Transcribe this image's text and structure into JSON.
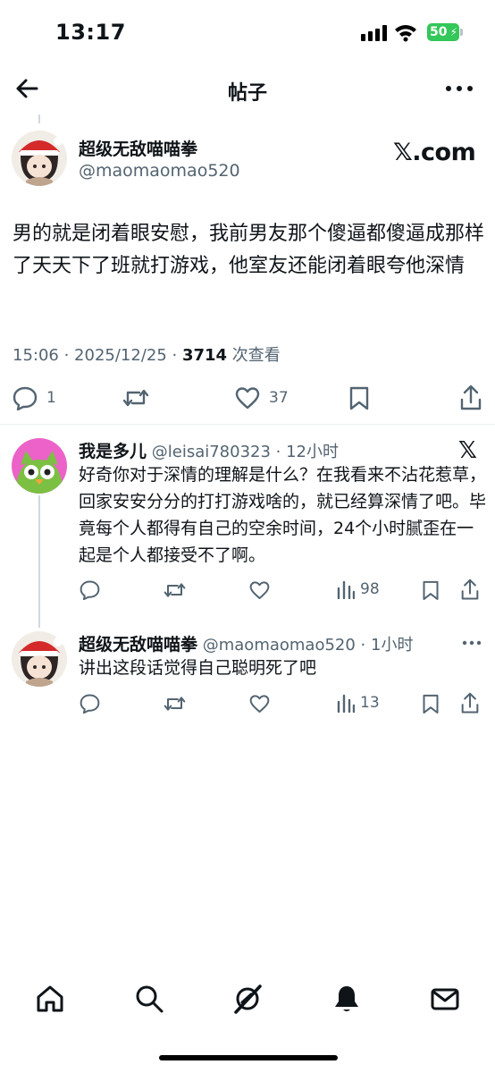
{
  "status_bar": {
    "time": "13:17",
    "battery": "50",
    "battery_color": "#34c759"
  },
  "header": {
    "title": "帖子",
    "back_icon": "arrow-left-icon",
    "more_icon": "ellipsis-horizontal-icon"
  },
  "post": {
    "author_name": "超级无敌喵喵拳",
    "author_handle": "@maomaomao520",
    "badge": "𝕏.com",
    "text": "男的就是闭着眼安慰，我前男友那个傻逼都傻逼成那样了天天下了班就打游戏，他室友还能闭着眼夸他深情",
    "time": "15:06 · 2025/12/25 · ",
    "views_count": "3714",
    "views_label": " 次查看",
    "replies": "1",
    "likes": "37"
  },
  "replies": [
    {
      "author_name": "我是多儿",
      "author_handle": " @leisai780323 · 12小时",
      "text": "好奇你对于深情的理解是什么？在我看来不沾花惹草，回家安安分分的打打游戏啥的，就已经算深情了吧。毕竟每个人都得有自己的空余时间，24个小时腻歪在一起是个人都接受不了啊。",
      "views": "98"
    },
    {
      "author_name": "超级无敌喵喵拳",
      "author_handle": " @maomaomao520 · 1小时",
      "text": "讲出这段话觉得自己聪明死了吧",
      "views": "13"
    }
  ],
  "tab_bar": {
    "items": [
      "home-icon",
      "search-icon",
      "grok-icon",
      "notifications-icon",
      "messages-icon"
    ]
  }
}
